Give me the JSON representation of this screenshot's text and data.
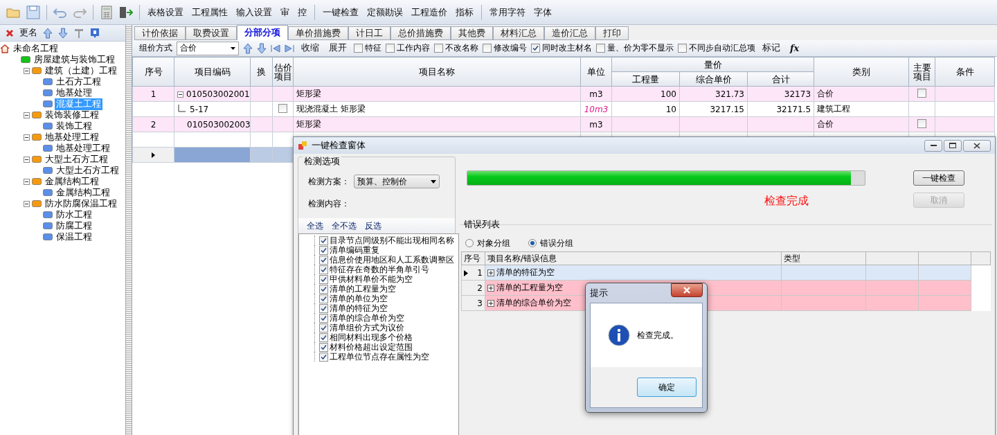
{
  "toolbar": {
    "groups": [
      [
        "表格设置",
        "工程属性",
        "输入设置",
        "审",
        "控"
      ],
      [
        "一键检查",
        "定额勘误",
        "工程造价",
        "指标"
      ],
      [
        "常用字符",
        "字体"
      ]
    ]
  },
  "tree_toolbar": {
    "rename": "更名"
  },
  "tree": [
    {
      "label": "未命名工程",
      "kind": "root",
      "selected": false,
      "children": [
        {
          "label": "房屋建筑与装饰工程",
          "kind": "unit",
          "selected": false,
          "children": [
            {
              "label": "建筑（土建）工程",
              "kind": "section",
              "expanded": true,
              "selected": false,
              "children": [
                {
                  "label": "土石方工程",
                  "kind": "item",
                  "selected": false
                },
                {
                  "label": "地基处理",
                  "kind": "item",
                  "selected": false
                },
                {
                  "label": "混凝土工程",
                  "kind": "item",
                  "selected": true
                }
              ]
            },
            {
              "label": "装饰装修工程",
              "kind": "section",
              "expanded": true,
              "selected": false,
              "children": [
                {
                  "label": "装饰工程",
                  "kind": "item",
                  "selected": false
                }
              ]
            },
            {
              "label": "地基处理工程",
              "kind": "section",
              "expanded": true,
              "selected": false,
              "children": [
                {
                  "label": "地基处理工程",
                  "kind": "item",
                  "selected": false
                }
              ]
            },
            {
              "label": "大型土石方工程",
              "kind": "section",
              "expanded": true,
              "selected": false,
              "children": [
                {
                  "label": "大型土石方工程",
                  "kind": "item",
                  "selected": false
                }
              ]
            },
            {
              "label": "金属结构工程",
              "kind": "section",
              "expanded": true,
              "selected": false,
              "children": [
                {
                  "label": "金属结构工程",
                  "kind": "item",
                  "selected": false
                }
              ]
            },
            {
              "label": "防水防腐保温工程",
              "kind": "section",
              "expanded": true,
              "selected": false,
              "children": [
                {
                  "label": "防水工程",
                  "kind": "item",
                  "selected": false
                },
                {
                  "label": "防腐工程",
                  "kind": "item",
                  "selected": false
                },
                {
                  "label": "保温工程",
                  "kind": "item",
                  "selected": false
                }
              ]
            }
          ]
        }
      ]
    }
  ],
  "tabs": [
    {
      "label": "计价依据",
      "selected": false
    },
    {
      "label": "取费设置",
      "selected": false
    },
    {
      "label": "分部分项",
      "selected": true
    },
    {
      "label": "单价措施费",
      "selected": false
    },
    {
      "label": "计日工",
      "selected": false
    },
    {
      "label": "总价措施费",
      "selected": false
    },
    {
      "label": "其他费",
      "selected": false
    },
    {
      "label": "材料汇总",
      "selected": false
    },
    {
      "label": "造价汇总",
      "selected": false
    },
    {
      "label": "打印",
      "selected": false
    }
  ],
  "options_bar": {
    "pricing_label": "组价方式",
    "pricing_value": "合价",
    "collapse": "收缩",
    "expand": "展开",
    "checkboxes": [
      {
        "label": "特征",
        "checked": false
      },
      {
        "label": "工作内容",
        "checked": false
      },
      {
        "label": "不改名称",
        "checked": false
      },
      {
        "label": "修改编号",
        "checked": false
      },
      {
        "label": "同时改主材名",
        "checked": true
      },
      {
        "label": "量、价为零不显示",
        "checked": false
      },
      {
        "label": "不同步自动汇总项",
        "checked": false
      }
    ],
    "mark": "标记",
    "formula": "fx"
  },
  "table": {
    "columns": [
      {
        "label": "序号"
      },
      {
        "label": "项目编码"
      },
      {
        "label": "换"
      },
      {
        "label": "估价项目"
      },
      {
        "label": "项目名称"
      },
      {
        "label": "单位"
      },
      {
        "label": "量价",
        "children": [
          "工程量",
          "综合单价",
          "合计"
        ]
      },
      {
        "label": "类别"
      },
      {
        "label": "主要项目"
      },
      {
        "label": "条件"
      }
    ],
    "rows": [
      {
        "kind": "bill",
        "number": "1",
        "code": "010503002001",
        "expanded": true,
        "name": "矩形梁",
        "unit": "m3",
        "quantity": "100",
        "unit_price": "321.73",
        "total": "32173",
        "category": "合价",
        "main_item": false,
        "selected": false
      },
      {
        "kind": "quota",
        "code": "5-17",
        "estimate": false,
        "name": "现浇混凝土 矩形梁",
        "unit": "10m3",
        "quantity": "10",
        "unit_price": "3217.15",
        "total": "32171.5",
        "category": "建筑工程",
        "selected": false
      },
      {
        "kind": "bill",
        "number": "2",
        "code": "010503002003",
        "name": "矩形梁",
        "unit": "m3",
        "category": "合价",
        "main_item": false,
        "selected": false
      },
      {
        "kind": "blank",
        "selected": false
      },
      {
        "kind": "blank",
        "selected": true
      }
    ]
  },
  "check_dialog": {
    "title": "一键检查窗体",
    "options_group": {
      "title": "检测选项",
      "scheme_label": "检测方案：",
      "scheme_value": "预算、控制价",
      "content_label": "检测内容：",
      "actions": [
        "全选",
        "全不选",
        "反选"
      ],
      "items": [
        {
          "label": "目录节点同级别不能出现相同名称",
          "checked": true
        },
        {
          "label": "清单编码重复",
          "checked": true
        },
        {
          "label": "信息价使用地区和人工系数调整区",
          "checked": true
        },
        {
          "label": "特征存在奇数的半角单引号",
          "checked": true
        },
        {
          "label": "甲供材料单价不能为空",
          "checked": true
        },
        {
          "label": "清单的工程量为空",
          "checked": true
        },
        {
          "label": "清单的单位为空",
          "checked": true
        },
        {
          "label": "清单的特征为空",
          "checked": true
        },
        {
          "label": "清单的综合单价为空",
          "checked": true
        },
        {
          "label": "清单组价方式为议价",
          "checked": true
        },
        {
          "label": "相同材料出现多个价格",
          "checked": true
        },
        {
          "label": "材料价格超出设定范围",
          "checked": true
        },
        {
          "label": "工程单位节点存在属性为空",
          "checked": true
        }
      ]
    },
    "progress": {
      "level": 0.965
    },
    "status": "检查完成",
    "buttons": [
      {
        "label": "一键检查",
        "disabled": false
      },
      {
        "label": "取消",
        "disabled": true
      }
    ],
    "errors": {
      "title": "错误列表",
      "groupings": [
        {
          "label": "对象分组",
          "selected": false
        },
        {
          "label": "错误分组",
          "selected": true
        }
      ],
      "columns": [
        "序号",
        "项目名称/错误信息",
        "类型"
      ],
      "rows": [
        {
          "number": "1",
          "message": "清单的特征为空",
          "selected": true
        },
        {
          "number": "2",
          "message": "清单的工程量为空",
          "selected": false
        },
        {
          "number": "3",
          "message": "清单的综合单价为空",
          "selected": false
        }
      ]
    }
  },
  "message_box": {
    "title": "提示",
    "message": "检查完成。",
    "button": "确定"
  }
}
